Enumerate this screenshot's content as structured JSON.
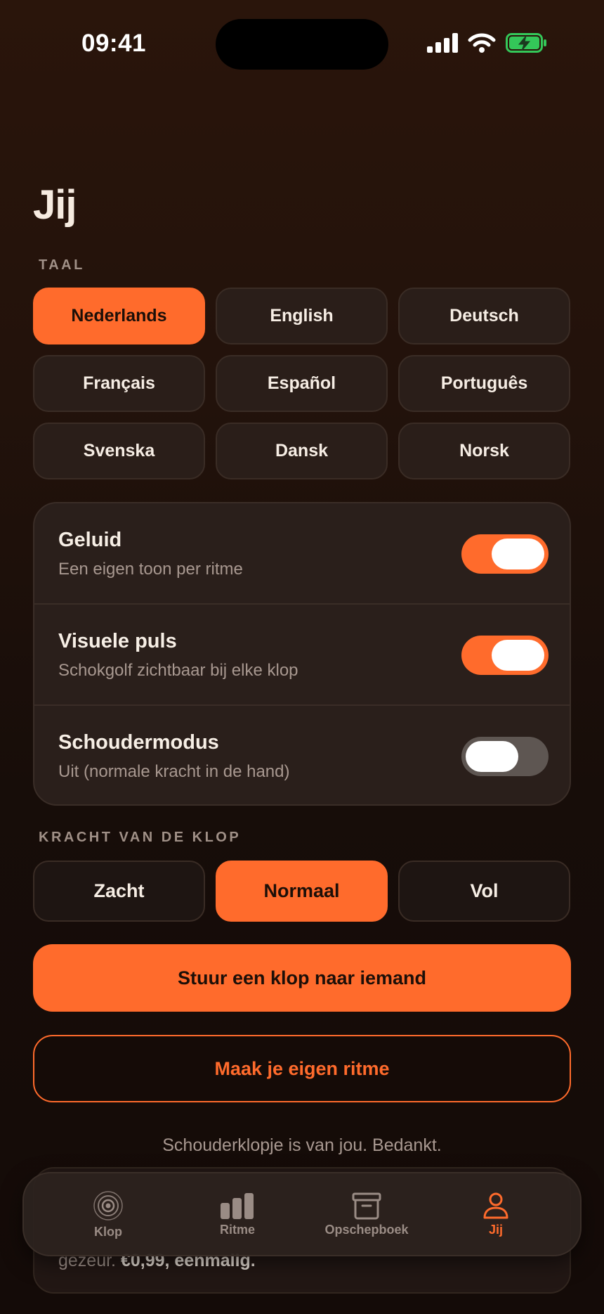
{
  "status_bar": {
    "time": "09:41"
  },
  "page": {
    "title": "Jij"
  },
  "language": {
    "label": "TAAL",
    "options": [
      "Nederlands",
      "English",
      "Deutsch",
      "Français",
      "Español",
      "Português",
      "Svenska",
      "Dansk",
      "Norsk"
    ],
    "selected": "Nederlands"
  },
  "settings": [
    {
      "title": "Geluid",
      "subtitle": "Een eigen toon per ritme",
      "enabled": true
    },
    {
      "title": "Visuele puls",
      "subtitle": "Schokgolf zichtbaar bij elke klop",
      "enabled": true
    },
    {
      "title": "Schoudermodus",
      "subtitle": "Uit (normale kracht in de hand)",
      "enabled": false
    }
  ],
  "force": {
    "label": "KRACHT VAN DE KLOP",
    "options": [
      "Zacht",
      "Normaal",
      "Vol"
    ],
    "selected": "Normaal"
  },
  "actions": {
    "send_label": "Stuur een klop naar iemand",
    "create_label": "Maak je eigen ritme"
  },
  "footer": {
    "thanks": "Schouderklopje is van jou. Bedankt.",
    "promo_prefix": "gezeur. ",
    "promo_price": "€0,99, eenmalig."
  },
  "tab_bar": {
    "items": [
      {
        "label": "Klop",
        "icon": "pulse-rings-icon"
      },
      {
        "label": "Ritme",
        "icon": "bars-icon"
      },
      {
        "label": "Opschepboek",
        "icon": "archive-box-icon"
      },
      {
        "label": "Jij",
        "icon": "person-icon"
      }
    ],
    "active": "Jij"
  },
  "colors": {
    "accent": "#ff6b2c",
    "background": "#1f100a",
    "card": "#2a1f1b",
    "battery": "#34c759"
  }
}
